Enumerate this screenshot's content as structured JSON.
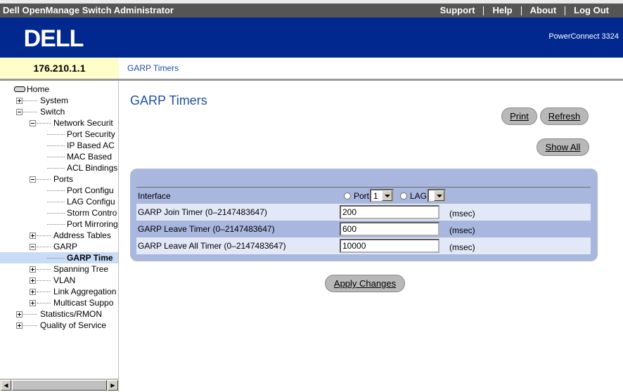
{
  "app": {
    "title": "Dell OpenManage Switch Administrator",
    "links": [
      "Support",
      "Help",
      "About",
      "Log Out"
    ],
    "model": "PowerConnect 3324"
  },
  "device": {
    "ip": "176.210.1.1"
  },
  "breadcrumb": "GARP Timers",
  "sidebar": {
    "home": "Home",
    "system": "System",
    "switch": "Switch",
    "network_security": "Network Securit",
    "port_security": "Port Security",
    "ip_based_acl": "IP Based AC",
    "mac_based_acl": "MAC Based",
    "acl_bindings": "ACL Bindings",
    "ports": "Ports",
    "port_configuration": "Port Configu",
    "lag_configuration": "LAG Configu",
    "storm_control": "Storm Contro",
    "port_mirroring": "Port Mirroring",
    "address_tables": "Address Tables",
    "garp": "GARP",
    "garp_timers": "GARP Time",
    "spanning_tree": "Spanning Tree",
    "vlan": "VLAN",
    "link_aggregation": "Link Aggregation",
    "multicast_support": "Multicast Suppo",
    "statistics_rmon": "Statistics/RMON",
    "quality_of_service": "Quality of Service"
  },
  "page": {
    "title": "GARP Timers",
    "print_label": "Print",
    "refresh_label": "Refresh",
    "show_all_label": "Show All",
    "apply_label": "Apply Changes"
  },
  "form": {
    "interface_label": "Interface",
    "port_label": "Port",
    "port_value": "1",
    "lag_label": "LAG",
    "lag_value": "",
    "join_label": "GARP Join Timer (0–2147483647)",
    "join_value": "200",
    "leave_label": "GARP Leave Timer (0–2147483647)",
    "leave_value": "600",
    "leave_all_label": "GARP Leave All Timer (0–2147483647)",
    "leave_all_value": "10000",
    "unit": "(msec)"
  },
  "colors": {
    "banner": "#00288f",
    "title_bar": "#555555",
    "ip_box": "#fffdc8",
    "panel": "#a9b7df",
    "link_blue": "#1f4fa3"
  }
}
